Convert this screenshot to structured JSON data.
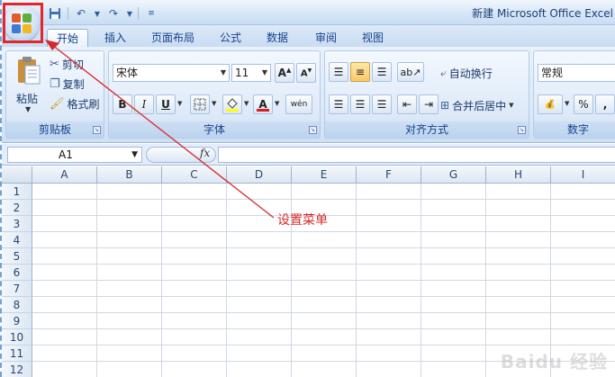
{
  "titlebar": {
    "title": "新建 Microsoft Office Excel"
  },
  "tabs": [
    "开始",
    "插入",
    "页面布局",
    "公式",
    "数据",
    "审阅",
    "视图"
  ],
  "clipboard": {
    "paste": "粘贴",
    "cut": "剪切",
    "copy": "复制",
    "format_painter": "格式刷",
    "group_label": "剪贴板"
  },
  "font": {
    "font_name": "宋体",
    "font_size": "11",
    "bold": "B",
    "italic": "I",
    "underline": "U",
    "color_glyph": "A",
    "phonetic": "wén",
    "group_label": "字体"
  },
  "alignment": {
    "wrap_text": "自动换行",
    "merge_center": "合并后居中",
    "group_label": "对齐方式"
  },
  "number": {
    "format": "常规",
    "percent": "%",
    "comma": ",",
    "group_label": "数字"
  },
  "formula_bar": {
    "name_box": "A1",
    "fx": "fx"
  },
  "grid": {
    "columns": [
      "A",
      "B",
      "C",
      "D",
      "E",
      "F",
      "G",
      "H",
      "I"
    ],
    "rows": [
      "1",
      "2",
      "3",
      "4",
      "5",
      "6",
      "7",
      "8",
      "9",
      "10",
      "11",
      "12"
    ]
  },
  "annotation": {
    "label": "设置菜单",
    "color": "#d62a2a"
  },
  "watermark": "Baidu 经验",
  "colors": {
    "accent": "#15428b",
    "highlight_box": "#e4262b"
  }
}
